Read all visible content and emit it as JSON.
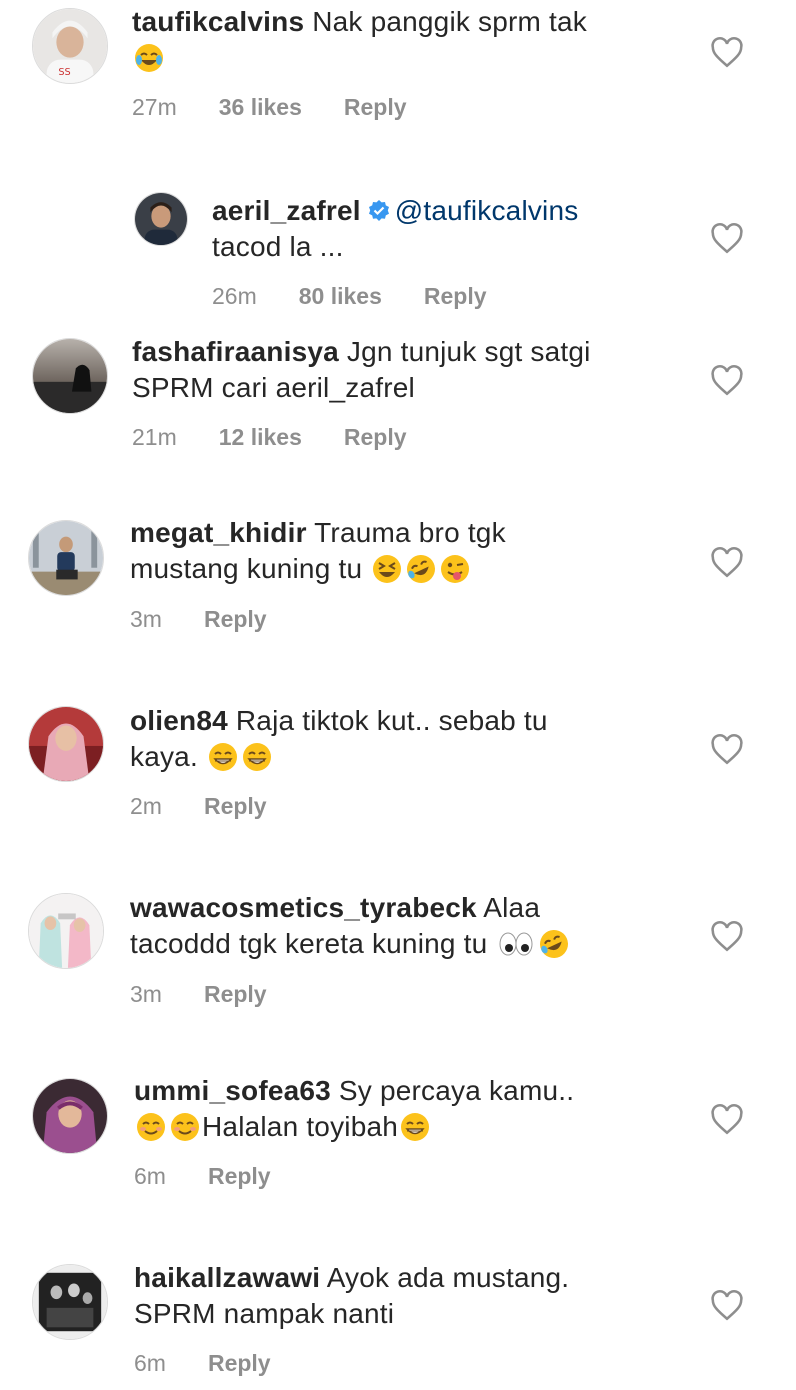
{
  "comments": [
    {
      "username": "taufikcalvins",
      "text": "Nak panggik sprm tak",
      "time": "27m",
      "likes": "36 likes",
      "reply": "Reply",
      "emojis": [
        "joy"
      ]
    },
    {
      "username": "aeril_zafrel",
      "mention": "@taufikcalvins",
      "text": "tacod la ...",
      "time": "26m",
      "likes": "80 likes",
      "reply": "Reply"
    },
    {
      "username": "fashafiraanisya",
      "text": "Jgn tunjuk sgt satgi",
      "text2": "SPRM cari aeril_zafrel",
      "time": "21m",
      "likes": "12 likes",
      "reply": "Reply"
    },
    {
      "username": "megat_khidir",
      "text": "Trauma bro tgk",
      "text2": "mustang kuning tu",
      "time": "3m",
      "reply": "Reply",
      "emojis": [
        "laughing",
        "rofl",
        "wink-tongue"
      ]
    },
    {
      "username": "olien84",
      "text": "Raja tiktok kut.. sebab tu",
      "text2": "kaya.",
      "time": "2m",
      "reply": "Reply",
      "emojis": [
        "grin",
        "grin"
      ]
    },
    {
      "username": "wawacosmetics_tyrabeck",
      "text": "Alaa",
      "text2": "tacoddd tgk kereta kuning tu",
      "time": "3m",
      "reply": "Reply",
      "emojis": [
        "eyes",
        "rofl"
      ]
    },
    {
      "username": "ummi_sofea63",
      "text": "Sy percaya kamu..",
      "text2": "Halalan toyibah",
      "time": "6m",
      "reply": "Reply",
      "emojis": [
        "smile",
        "smile",
        "grin"
      ]
    },
    {
      "username": "haikallzawawi",
      "text": "Ayok ada mustang.",
      "text2": "SPRM nampak nanti",
      "time": "6m",
      "reply": "Reply"
    }
  ],
  "colors": {
    "text": "#262626",
    "meta": "#8e8e8e",
    "mention": "#00376b",
    "verified": "#3897f0"
  },
  "icons": {
    "like": "heart-outline-icon",
    "verified": "verified-badge-icon"
  }
}
